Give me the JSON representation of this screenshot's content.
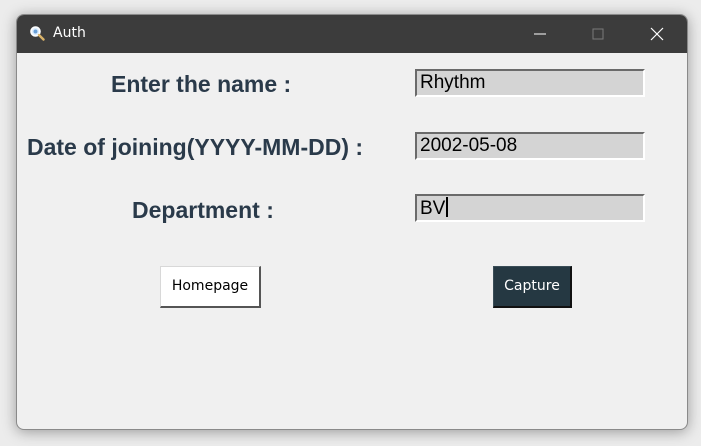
{
  "window": {
    "title": "Auth",
    "icon": "magnifier-icon",
    "controls": [
      "minimize-icon",
      "maximize-icon",
      "close-icon"
    ]
  },
  "form": {
    "name_label": "Enter the name :",
    "name_value": "Rhythm",
    "doj_label": "Date of joining(YYYY-MM-DD) :",
    "doj_value": "2002-05-08",
    "dept_label": "Department :",
    "dept_value": "BV"
  },
  "buttons": {
    "homepage_label": "Homepage",
    "capture_label": "Capture"
  },
  "colors": {
    "titlebar": "#3c3c3c",
    "label_text": "#2a3a4a",
    "field_bg": "#d4d4d4",
    "capture_bg": "#253842"
  }
}
